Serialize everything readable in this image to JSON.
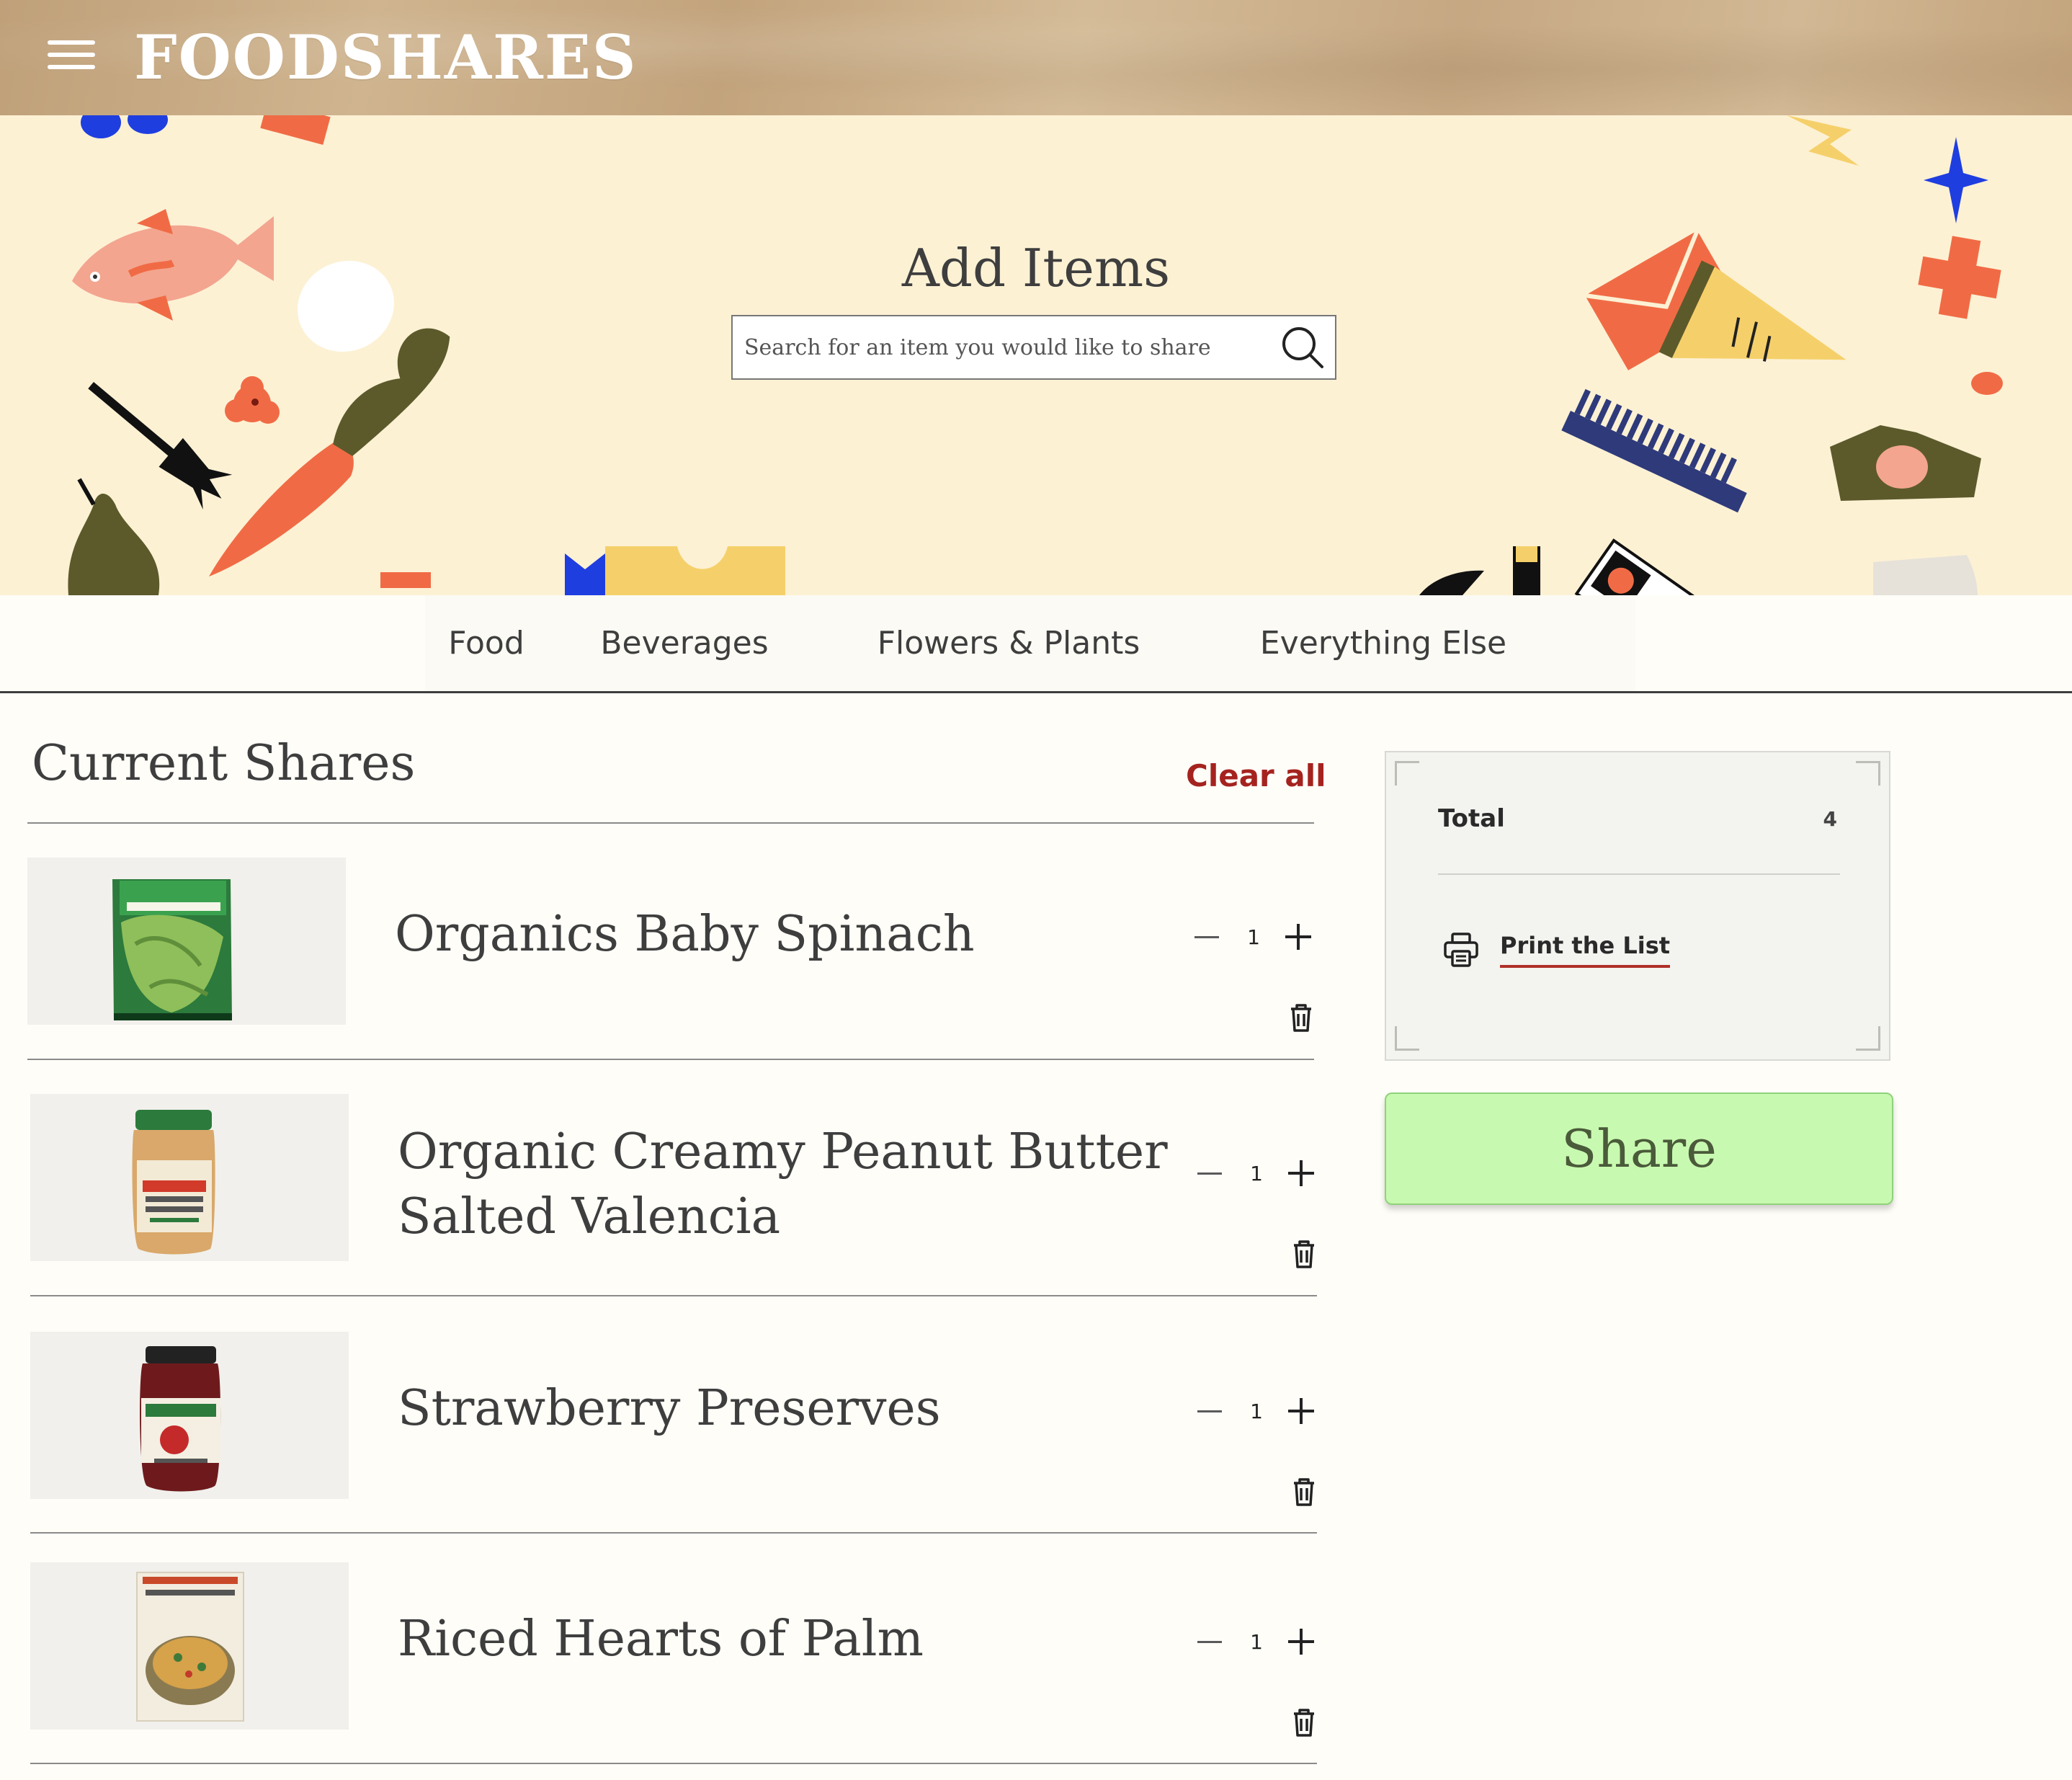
{
  "app": {
    "logo": "FOODSHARES"
  },
  "hero": {
    "title": "Add Items",
    "search_placeholder": "Search for an item you would like to share"
  },
  "tabs": [
    {
      "label": "Food"
    },
    {
      "label": "Beverages"
    },
    {
      "label": "Flowers & Plants"
    },
    {
      "label": "Everything Else"
    }
  ],
  "shares": {
    "title": "Current Shares",
    "clear_label": "Clear all",
    "items": [
      {
        "name": "Organics Baby Spinach",
        "qty": "1"
      },
      {
        "name": "Organic Creamy Peanut Butter Salted Valencia",
        "qty": "1"
      },
      {
        "name": "Strawberry Preserves",
        "qty": "1"
      },
      {
        "name": "Riced Hearts of Palm",
        "qty": "1"
      }
    ]
  },
  "summary": {
    "total_label": "Total",
    "total_value": "4",
    "print_label": "Print the List"
  },
  "share_button": {
    "label": "Share"
  },
  "colors": {
    "accent_red": "#a5231f",
    "share_green": "#c8f9b0",
    "hero_bg": "#fdf1d4"
  }
}
